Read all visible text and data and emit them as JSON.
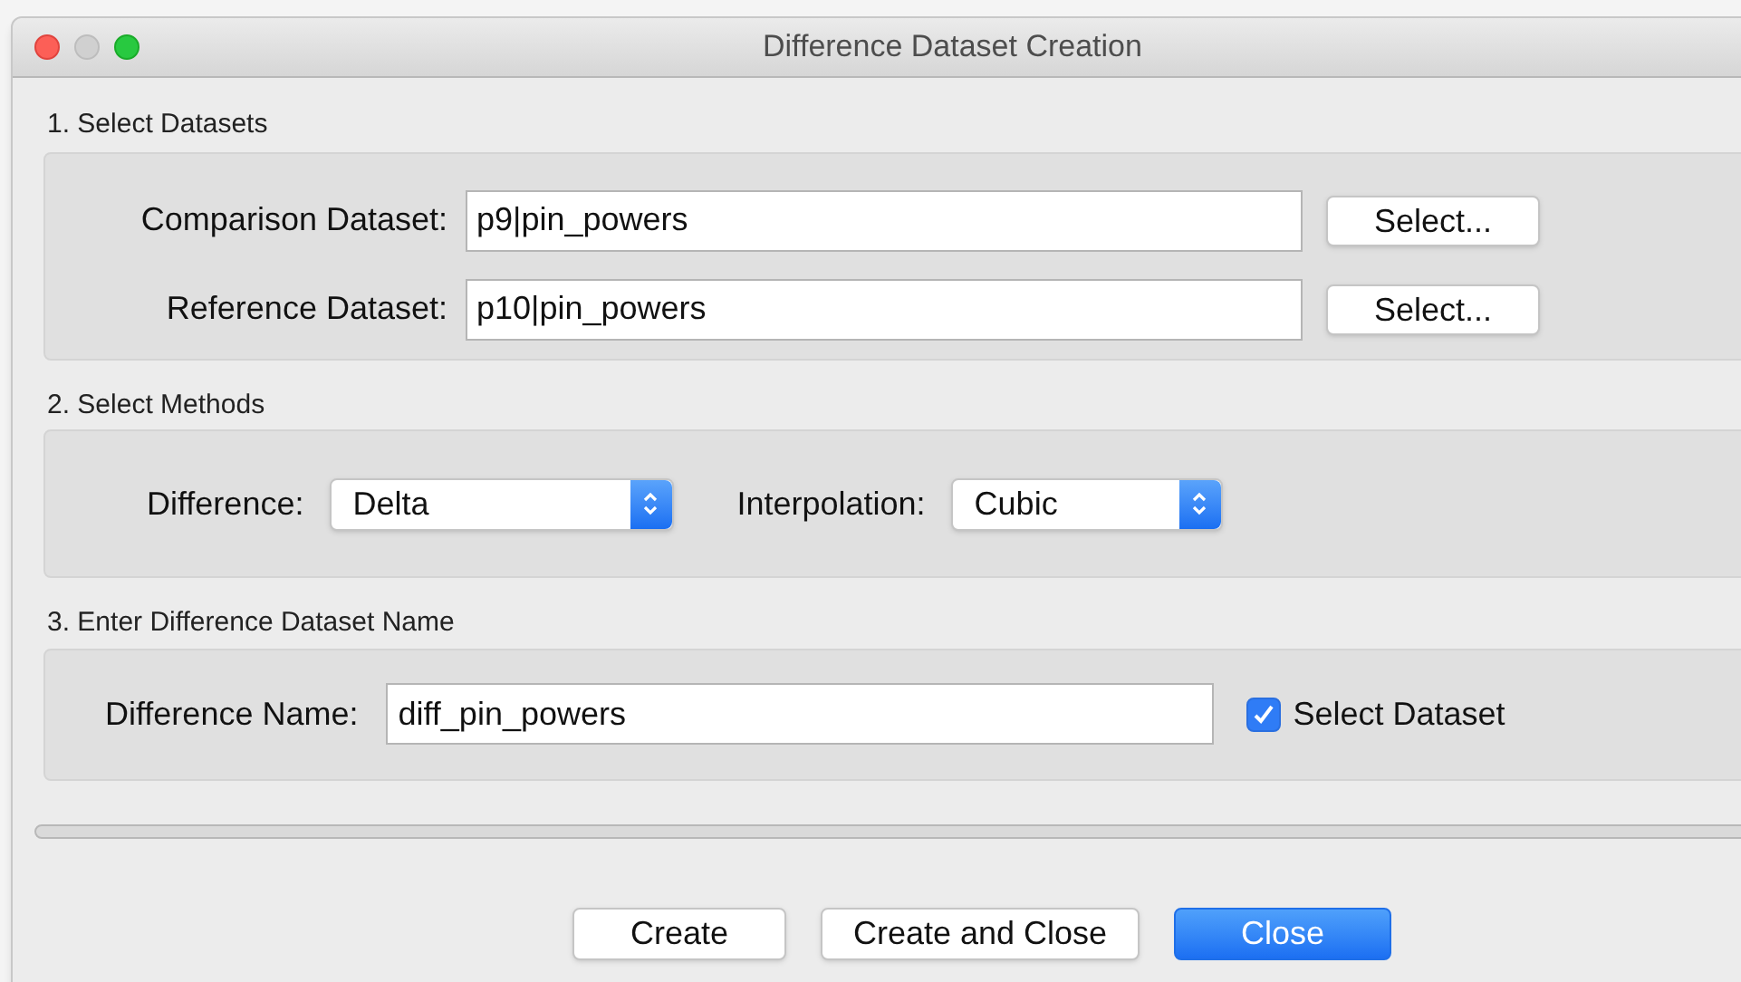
{
  "window": {
    "title": "Difference Dataset Creation"
  },
  "datasets": {
    "heading": "1. Select Datasets",
    "fields": [
      {
        "label": "Comparison Dataset:",
        "value": "p9|pin_powers",
        "button": "Select..."
      },
      {
        "label": "Reference Dataset:",
        "value": "p10|pin_powers",
        "button": "Select..."
      }
    ]
  },
  "methods": {
    "heading": "2. Select Methods",
    "dropdowns": [
      {
        "label": "Difference:",
        "value": "Delta"
      },
      {
        "label": "Interpolation:",
        "value": "Cubic"
      }
    ]
  },
  "name_section": {
    "heading": "3. Enter Difference Dataset Name",
    "label": "Difference Name:",
    "value": "diff_pin_powers",
    "checkbox": {
      "label": "Select Dataset",
      "checked": true
    }
  },
  "progress": {
    "level": 0
  },
  "buttons": [
    {
      "label": "Create",
      "default": false
    },
    {
      "label": "Create and Close",
      "default": false
    },
    {
      "label": "Close",
      "default": true
    }
  ]
}
